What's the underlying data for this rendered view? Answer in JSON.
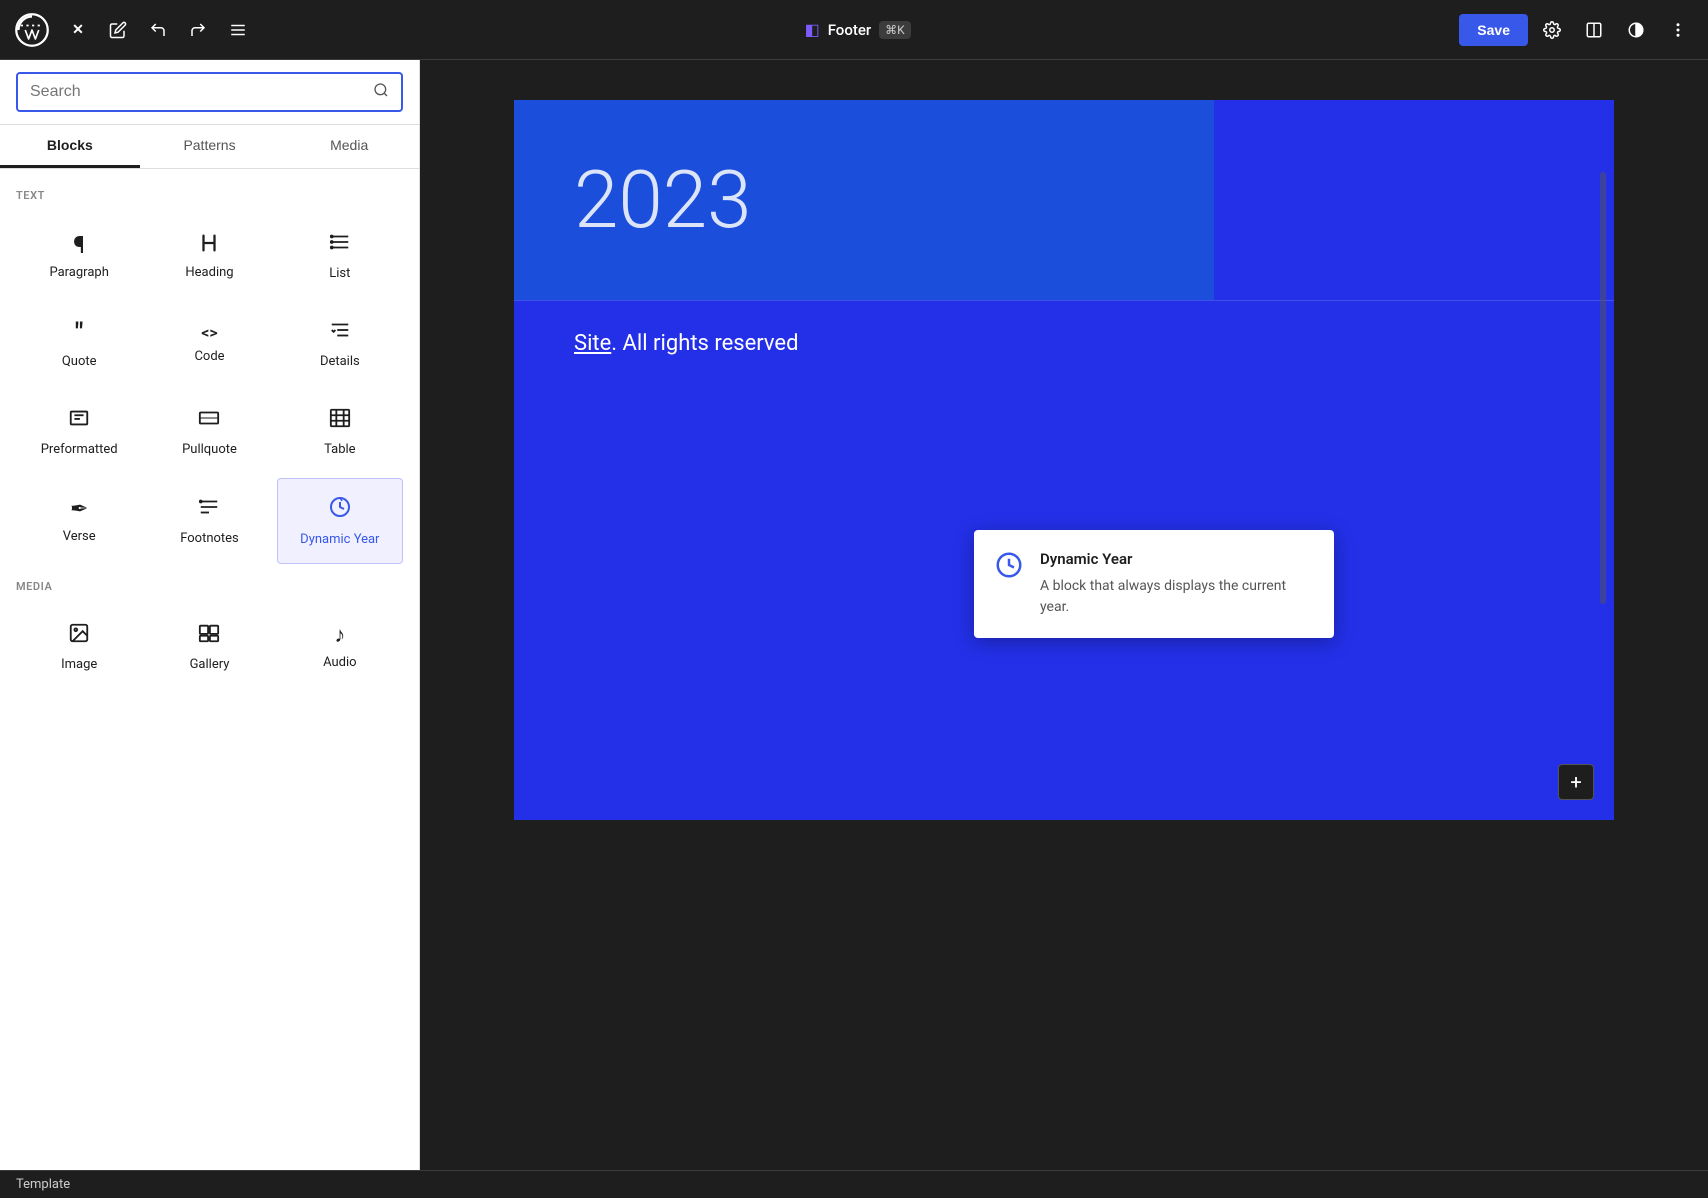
{
  "toolbar": {
    "close_label": "✕",
    "title": "Footer",
    "keyboard_shortcut": "⌘K",
    "save_label": "Save",
    "footer_icon": "◧"
  },
  "sidebar": {
    "search_placeholder": "Search",
    "tabs": [
      {
        "id": "blocks",
        "label": "Blocks",
        "active": true
      },
      {
        "id": "patterns",
        "label": "Patterns",
        "active": false
      },
      {
        "id": "media",
        "label": "Media",
        "active": false
      }
    ],
    "categories": [
      {
        "id": "text",
        "label": "TEXT",
        "blocks": [
          {
            "id": "paragraph",
            "label": "Paragraph",
            "icon": "¶"
          },
          {
            "id": "heading",
            "label": "Heading",
            "icon": "🔖"
          },
          {
            "id": "list",
            "label": "List",
            "icon": "≡"
          },
          {
            "id": "quote",
            "label": "Quote",
            "icon": "❝"
          },
          {
            "id": "code",
            "label": "Code",
            "icon": "<>"
          },
          {
            "id": "details",
            "label": "Details",
            "icon": "☰"
          },
          {
            "id": "preformatted",
            "label": "Preformatted",
            "icon": "▭"
          },
          {
            "id": "pullquote",
            "label": "Pullquote",
            "icon": "▬"
          },
          {
            "id": "table",
            "label": "Table",
            "icon": "⊞"
          },
          {
            "id": "verse",
            "label": "Verse",
            "icon": "✒"
          },
          {
            "id": "footnotes",
            "label": "Footnotes",
            "icon": "≔"
          },
          {
            "id": "dynamic-year",
            "label": "Dynamic Year",
            "icon": "⊙",
            "highlighted": true,
            "blue": true
          }
        ]
      },
      {
        "id": "media",
        "label": "MEDIA",
        "blocks": [
          {
            "id": "image",
            "label": "Image",
            "icon": "▭"
          },
          {
            "id": "gallery",
            "label": "Gallery",
            "icon": "▭▭"
          },
          {
            "id": "audio",
            "label": "Audio",
            "icon": "♪"
          }
        ]
      }
    ]
  },
  "tooltip": {
    "title": "Dynamic Year",
    "description": "A block that always displays the current year.",
    "icon": "⊙"
  },
  "canvas": {
    "year": "2023",
    "rights_text": ". All rights reserved",
    "site_link": "Site",
    "add_btn": "+"
  },
  "status_bar": {
    "label": "Template"
  }
}
